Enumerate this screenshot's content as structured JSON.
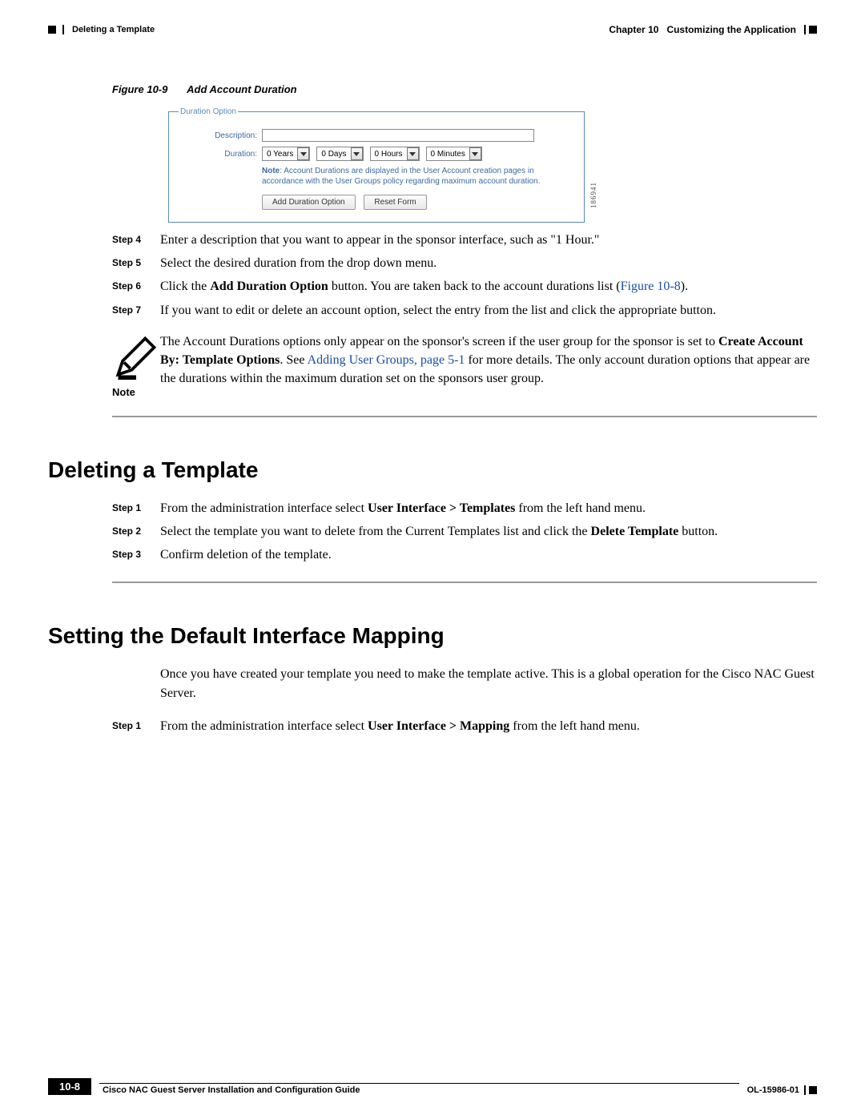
{
  "header": {
    "left_section": "Deleting a Template",
    "chapter_label": "Chapter 10",
    "chapter_title": "Customizing the Application"
  },
  "figure": {
    "label": "Figure 10-9",
    "title": "Add Account Duration"
  },
  "screenshot": {
    "legend": "Duration Option",
    "desc_label": "Description:",
    "dur_label": "Duration:",
    "dd_years": "0 Years",
    "dd_days": "0 Days",
    "dd_hours": "0 Hours",
    "dd_minutes": "0 Minutes",
    "note_prefix": "Note",
    "note_text": ": Account Durations are displayed in the User Account creation pages in accordance with the User Groups policy regarding maximum account duration.",
    "btn_add": "Add Duration Option",
    "btn_reset": "Reset Form",
    "sidecode": "186941"
  },
  "steps_a": [
    {
      "label": "Step 4",
      "text": "Enter a description that you want to appear in the sponsor interface, such as \"1 Hour.\""
    },
    {
      "label": "Step 5",
      "text": "Select the desired duration from the drop down menu."
    },
    {
      "label": "Step 6",
      "pre": "Click the ",
      "bold": "Add Duration Option",
      "mid": " button. You are taken back to the account durations list (",
      "link": "Figure 10-8",
      "post": ")."
    },
    {
      "label": "Step 7",
      "text": "If you want to edit or delete an account option, select the entry from the list and click the appropriate button."
    }
  ],
  "note": {
    "label": "Note",
    "t1": "The Account Durations options only appear on the sponsor's screen if the user group for the sponsor is set to ",
    "b1": "Create Account By: Template Options",
    "t2": ". See ",
    "link": "Adding User Groups, page 5-1",
    "t3": " for more details. The only account duration options that appear are the durations within the maximum duration set on the sponsors user group."
  },
  "section1": {
    "title": "Deleting a Template",
    "steps": [
      {
        "label": "Step 1",
        "pre": "From the administration interface select ",
        "bold": "User Interface > Templates",
        "post": " from the left hand menu."
      },
      {
        "label": "Step 2",
        "pre": "Select the template you want to delete from the Current Templates list and click the ",
        "bold": "Delete Template",
        "post": " button."
      },
      {
        "label": "Step 3",
        "text": "Confirm deletion of the template."
      }
    ]
  },
  "section2": {
    "title": "Setting the Default Interface Mapping",
    "intro": "Once you have created your template you need to make the template active. This is a global operation for the Cisco NAC Guest Server.",
    "steps": [
      {
        "label": "Step 1",
        "pre": "From the administration interface select ",
        "bold": "User Interface > Mapping",
        "post": " from the left hand menu."
      }
    ]
  },
  "footer": {
    "guide": "Cisco NAC Guest Server Installation and Configuration Guide",
    "page": "10-8",
    "code": "OL-15986-01"
  }
}
